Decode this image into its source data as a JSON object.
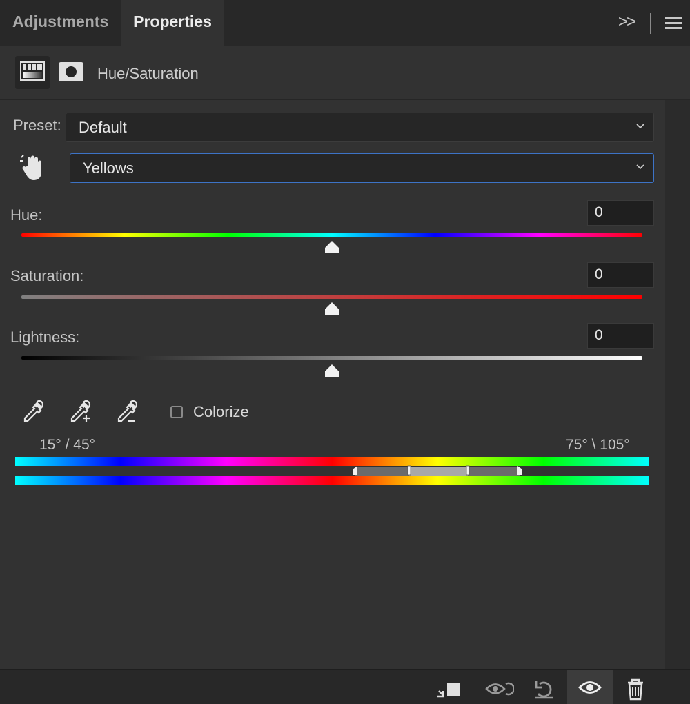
{
  "tabs": {
    "adjustments_label": "Adjustments",
    "properties_label": "Properties"
  },
  "header": {
    "title": "Hue/Saturation",
    "icons": [
      "hue-saturation-adjustment-icon",
      "layer-mask-icon"
    ]
  },
  "preset": {
    "label": "Preset:",
    "value": "Default"
  },
  "channel": {
    "value": "Yellows",
    "icon": "targeted-adjustment-hand-icon"
  },
  "hue": {
    "label": "Hue:",
    "value": "0",
    "slider_fraction": 0.5
  },
  "saturation": {
    "label": "Saturation:",
    "value": "0",
    "slider_fraction": 0.5
  },
  "lightness": {
    "label": "Lightness:",
    "value": "0",
    "slider_fraction": 0.5
  },
  "tools": [
    "eyedropper-icon",
    "eyedropper-add-icon",
    "eyedropper-subtract-icon"
  ],
  "colorize": {
    "label": "Colorize",
    "checked": false
  },
  "range": {
    "left_values": "15° /  45°",
    "right_values": "75° \\  105°"
  },
  "bottom_icons": [
    "clip-to-layer-icon",
    "view-previous-state-icon",
    "reset-icon",
    "visibility-eye-icon",
    "delete-trash-icon"
  ],
  "colors": {
    "panel_bg": "#323232",
    "tabbar_bg": "#282828",
    "focus_border": "#3d73c6"
  }
}
